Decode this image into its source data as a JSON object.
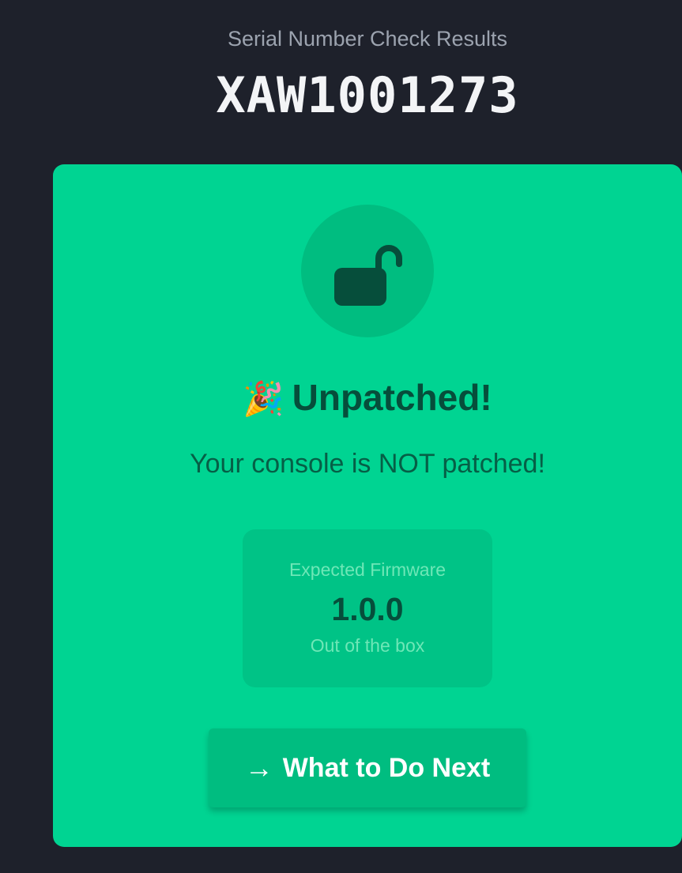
{
  "header": {
    "subtitle": "Serial Number Check Results",
    "serial": "XAW1001273"
  },
  "result_card": {
    "icon": "unlocked-padlock-icon",
    "title_emoji": "🎉",
    "title": "Unpatched!",
    "description": "Your console is NOT patched!",
    "firmware": {
      "label": "Expected Firmware",
      "value": "1.0.0",
      "note": "Out of the box"
    },
    "button": {
      "arrow": "→",
      "label": "What to Do Next"
    }
  },
  "colors": {
    "background": "#1e212b",
    "card": "#00d492",
    "card_accent": "#00bd80",
    "dark_text": "#064e3b"
  }
}
